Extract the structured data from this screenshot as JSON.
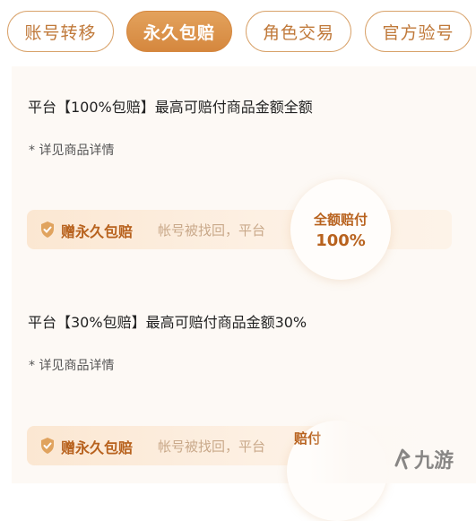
{
  "tabs": [
    {
      "label": "账号转移"
    },
    {
      "label": "永久包赔"
    },
    {
      "label": "角色交易"
    },
    {
      "label": "官方验号"
    }
  ],
  "active_tab": "永久包赔",
  "section1": {
    "title": "平台【100%包赔】最高可赔付商品金额全额",
    "note": "* 详见商品详情",
    "bar_label": "赠永久包赔",
    "bar_text": "帐号被找回，平台",
    "bar_text_tail": "",
    "circle_line1": "全额赔付",
    "circle_line2": "100%"
  },
  "section2": {
    "title": "平台【30%包赔】最高可赔付商品金额30%",
    "note": "* 详见商品详情",
    "bar_label": "赠永久包赔",
    "bar_text": "帐号被找回，平台",
    "circle_line1": "赔付"
  },
  "watermark": {
    "text": "九游"
  },
  "colors": {
    "accent": "#d5873e",
    "accent_text": "#b8621e",
    "tab_border": "#d9a36b"
  }
}
